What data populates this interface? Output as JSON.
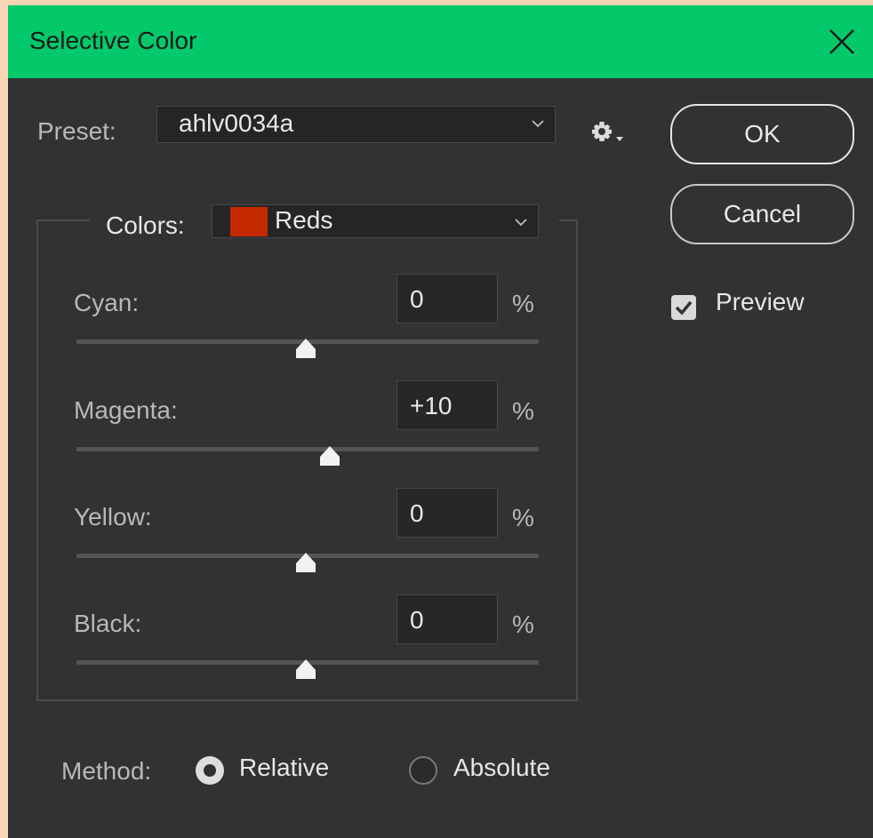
{
  "window": {
    "title": "Selective Color"
  },
  "preset": {
    "label": "Preset:",
    "value": "ahlv0034a"
  },
  "colors": {
    "label": "Colors:",
    "value": "Reds",
    "swatch": "#c42a00"
  },
  "sliders": [
    {
      "label": "Cyan:",
      "value": "0",
      "unit": "%",
      "level": 0
    },
    {
      "label": "Magenta:",
      "value": "+10",
      "unit": "%",
      "level": 10
    },
    {
      "label": "Yellow:",
      "value": "0",
      "unit": "%",
      "level": 0
    },
    {
      "label": "Black:",
      "value": "0",
      "unit": "%",
      "level": 0
    }
  ],
  "buttons": {
    "ok": "OK",
    "cancel": "Cancel"
  },
  "preview": {
    "label": "Preview",
    "checked": true
  },
  "method": {
    "label": "Method:",
    "options": [
      {
        "label": "Relative",
        "selected": true
      },
      {
        "label": "Absolute",
        "selected": false
      }
    ]
  },
  "theme": {
    "titlebar": "#04c96b",
    "panel": "#323232"
  }
}
